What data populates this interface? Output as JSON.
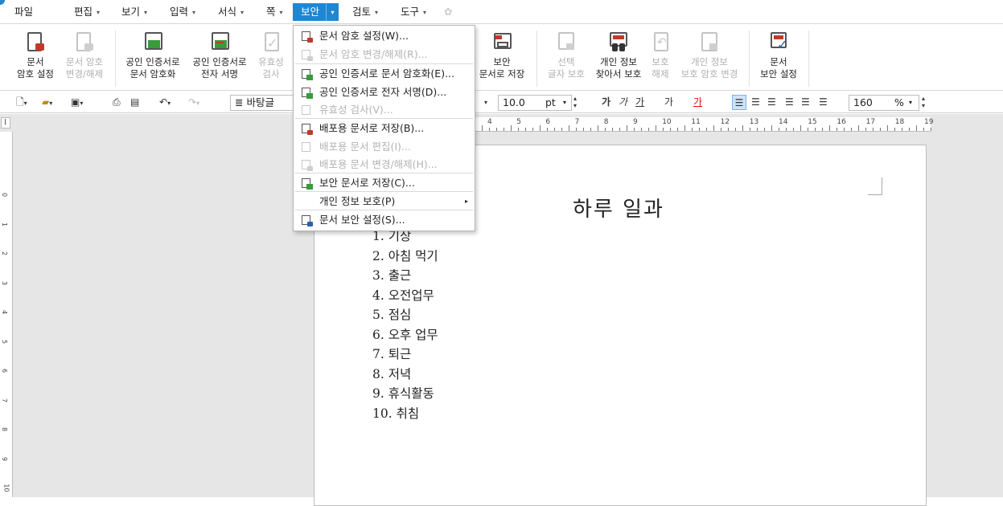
{
  "menubar": {
    "file": "파일",
    "items": [
      "편집",
      "보기",
      "입력",
      "서식",
      "쪽",
      "보안",
      "검토",
      "도구"
    ]
  },
  "ribbon": {
    "doc_password_set": [
      "문서",
      "암호 설정"
    ],
    "doc_password_change": [
      "문서 암호",
      "변경/해제"
    ],
    "cert_encrypt": [
      "공인 인증서로",
      "문서 암호화"
    ],
    "cert_sign": [
      "공인 인증서로",
      "전자 서명"
    ],
    "validity_check": [
      "유효성",
      "검사"
    ],
    "save_secure": [
      "보안",
      "문서로 저장"
    ],
    "select_protect": [
      "선택",
      "글자 보호"
    ],
    "find_protect": [
      "개인 정보",
      "찾아서 보호"
    ],
    "unprotect": [
      "보호",
      "해제"
    ],
    "change_protect_pw": [
      "개인 정보",
      "보호 암호 변경"
    ],
    "doc_security_settings": [
      "문서",
      "보안 설정"
    ]
  },
  "toolbar": {
    "font_style": "바탕글",
    "font_size": "10.0",
    "font_unit": "pt",
    "zoom": "160",
    "zoom_unit": "%",
    "bold": "가",
    "italic": "가",
    "underline": "가",
    "strike": "가",
    "color": "가"
  },
  "ruler": {
    "h_numbers": [
      "4",
      "5",
      "6",
      "7",
      "8",
      "9",
      "10",
      "11",
      "12",
      "13",
      "14",
      "15",
      "16",
      "17",
      "18",
      "19"
    ],
    "v_numbers": [
      "0",
      "1",
      "2",
      "3",
      "4",
      "5",
      "6",
      "7",
      "8",
      "9",
      "10"
    ]
  },
  "dropdown": {
    "items": [
      {
        "label": "문서 암호 설정(W)...",
        "enabled": true
      },
      {
        "label": "문서 암호 변경/해제(R)...",
        "enabled": false
      },
      {
        "label": "공인 인증서로 문서 암호화(E)...",
        "enabled": true
      },
      {
        "label": "공인 인증서로 전자 서명(D)...",
        "enabled": true
      },
      {
        "label": "유효성 검사(V)...",
        "enabled": false
      },
      {
        "label": "배포용 문서로 저장(B)...",
        "enabled": true
      },
      {
        "label": "배포용 문서 편집(I)...",
        "enabled": false
      },
      {
        "label": "배포용 문서 변경/해제(H)...",
        "enabled": false
      },
      {
        "label": "보안 문서로 저장(C)...",
        "enabled": true
      },
      {
        "label": "개인 정보 보호(P)",
        "enabled": true
      },
      {
        "label": "문서 보안 설정(S)...",
        "enabled": true
      }
    ]
  },
  "document": {
    "title": "하루 일과",
    "list": [
      "1.  기상",
      "2.  아침 먹기",
      "3.  출근",
      "4.  오전업무",
      "5.  점심",
      "6.  오후 업무",
      "7.  퇴근",
      "8.  저녁",
      "9.  휴식활동",
      "10.  취침"
    ]
  }
}
